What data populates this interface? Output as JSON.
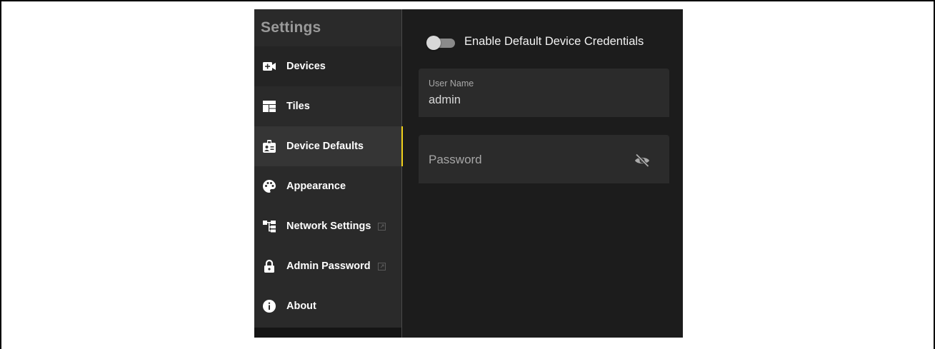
{
  "sidebar": {
    "title": "Settings",
    "items": [
      {
        "label": "Devices",
        "icon": "video-plus-icon"
      },
      {
        "label": "Tiles",
        "icon": "tiles-icon"
      },
      {
        "label": "Device Defaults",
        "icon": "badge-account-icon",
        "active": true
      },
      {
        "label": "Appearance",
        "icon": "palette-icon"
      },
      {
        "label": "Network Settings",
        "icon": "network-icon",
        "external": true
      },
      {
        "label": "Admin Password",
        "icon": "lock-icon",
        "external": true
      },
      {
        "label": "About",
        "icon": "info-icon"
      }
    ]
  },
  "main": {
    "toggle": {
      "label": "Enable Default Device Credentials",
      "enabled": false
    },
    "username": {
      "label": "User Name",
      "value": "admin"
    },
    "password": {
      "placeholder": "Password",
      "icon": "eye-off-icon"
    }
  },
  "colors": {
    "accent": "#f2d21b",
    "sidebar_bg": "#2a2a2a",
    "content_bg": "#1c1c1c",
    "field_bg": "#2b2b2b"
  }
}
